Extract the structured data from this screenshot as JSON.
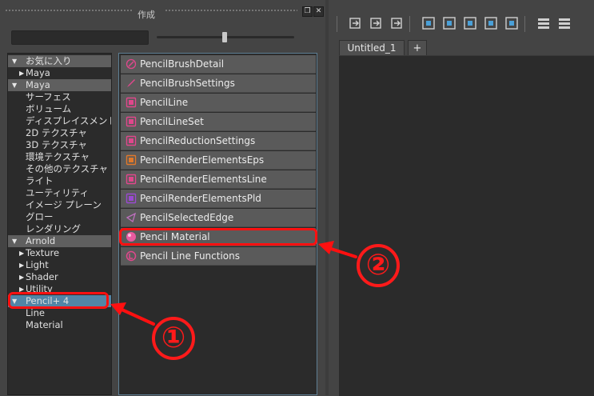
{
  "panel": {
    "title": "作成",
    "search_value": "",
    "icon_size_percent": 50
  },
  "tree": {
    "items": [
      {
        "label": "お気に入り",
        "kind": "category",
        "expanded": true
      },
      {
        "label": "Maya",
        "kind": "child-collapsed"
      },
      {
        "label": "Maya",
        "kind": "category",
        "expanded": true
      },
      {
        "label": "サーフェス",
        "kind": "leaf"
      },
      {
        "label": "ボリューム",
        "kind": "leaf"
      },
      {
        "label": "ディスプレイスメント",
        "kind": "leaf"
      },
      {
        "label": "2D テクスチャ",
        "kind": "leaf"
      },
      {
        "label": "3D テクスチャ",
        "kind": "leaf"
      },
      {
        "label": "環境テクスチャ",
        "kind": "leaf"
      },
      {
        "label": "その他のテクスチャ",
        "kind": "leaf"
      },
      {
        "label": "ライト",
        "kind": "leaf"
      },
      {
        "label": "ユーティリティ",
        "kind": "leaf"
      },
      {
        "label": "イメージ プレーン",
        "kind": "leaf"
      },
      {
        "label": "グロー",
        "kind": "leaf"
      },
      {
        "label": "レンダリング",
        "kind": "leaf"
      },
      {
        "label": "Arnold",
        "kind": "category",
        "expanded": true
      },
      {
        "label": "Texture",
        "kind": "child-collapsed"
      },
      {
        "label": "Light",
        "kind": "child-collapsed"
      },
      {
        "label": "Shader",
        "kind": "child-collapsed"
      },
      {
        "label": "Utility",
        "kind": "child-collapsed"
      },
      {
        "label": "Pencil+ 4",
        "kind": "category-selected",
        "expanded": true
      },
      {
        "label": "Line",
        "kind": "leaf"
      },
      {
        "label": "Material",
        "kind": "leaf"
      }
    ]
  },
  "nodes": {
    "items": [
      {
        "label": "PencilBrushDetail",
        "icon": "brush-detail-icon",
        "color": "#e0478c"
      },
      {
        "label": "PencilBrushSettings",
        "icon": "brush-settings-icon",
        "color": "#e0478c"
      },
      {
        "label": "PencilLine",
        "icon": "pencil-line-icon",
        "color": "#e0478c"
      },
      {
        "label": "PencilLineSet",
        "icon": "line-set-icon",
        "color": "#e0478c"
      },
      {
        "label": "PencilReductionSettings",
        "icon": "reduction-settings-icon",
        "color": "#e0478c"
      },
      {
        "label": "PencilRenderElementsEps",
        "icon": "render-elements-eps-icon",
        "color": "#e0782b"
      },
      {
        "label": "PencilRenderElementsLine",
        "icon": "render-elements-line-icon",
        "color": "#e0478c"
      },
      {
        "label": "PencilRenderElementsPld",
        "icon": "render-elements-pld-icon",
        "color": "#9a4ad0"
      },
      {
        "label": "PencilSelectedEdge",
        "icon": "selected-edge-icon",
        "color": "#c070c0"
      },
      {
        "label": "Pencil Material",
        "icon": "pencil-material-icon",
        "color": "#e85aa0"
      },
      {
        "label": "Pencil Line Functions",
        "icon": "line-functions-icon",
        "color": "#e0478c"
      }
    ]
  },
  "editor": {
    "tabs": [
      {
        "label": "Untitled_1"
      },
      {
        "label": "+"
      }
    ],
    "toolbar_icons": [
      "graph-input-icon",
      "graph-input-output-icon",
      "graph-output-icon",
      "frame-selection-icon",
      "add-selected-icon",
      "remove-selected-icon",
      "rearrange-graph-icon",
      "clear-graph-icon",
      "layout-simple-icon",
      "layout-connected-icon"
    ]
  },
  "annotations": {
    "callout_1": "①",
    "callout_2": "②",
    "accent_color": "#ff1010"
  }
}
